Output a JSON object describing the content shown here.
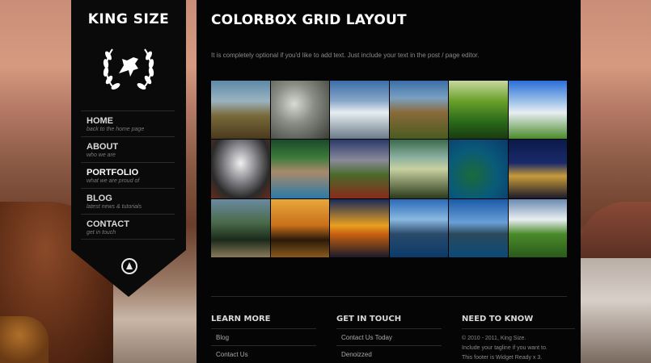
{
  "site": {
    "logo_text": "KING SIZE"
  },
  "nav": [
    {
      "label": "HOME",
      "sub": "back to the home page"
    },
    {
      "label": "ABOUT",
      "sub": "who we are"
    },
    {
      "label": "PORTFOLIO",
      "sub": "what we are proud of"
    },
    {
      "label": "BLOG",
      "sub": "latest news & tutorials"
    },
    {
      "label": "CONTACT",
      "sub": "get in touch"
    }
  ],
  "main": {
    "title": "COLORBOX GRID LAYOUT",
    "intro": "It is completely optional if you'd like to add text.  Just include your text in the post / page editor."
  },
  "footer": {
    "learn_more": {
      "heading": "LEARN MORE",
      "links": [
        "Blog",
        "Contact Us"
      ]
    },
    "get_in_touch": {
      "heading": "GET IN TOUCH",
      "links": [
        "Contact Us Today",
        "Denoizzed"
      ]
    },
    "need_to_know": {
      "heading": "NEED TO KNOW",
      "lines": [
        "© 2010 - 2011, King Size.",
        "Include your tagline if you want to.",
        "This footer is Widget Ready x 3."
      ]
    }
  },
  "colors": {
    "panel": "#050505",
    "sidebar": "#0a0a0a",
    "text_light": "#ffffff",
    "text_muted": "#8a8a8a"
  }
}
